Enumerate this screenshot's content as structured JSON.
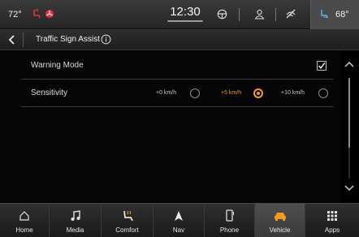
{
  "status_bar": {
    "temp_left": "72°",
    "clock": "12:30",
    "temp_right": "68°",
    "icons": [
      "heated-seat-icon",
      "fan-icon",
      "steering-wheel-icon",
      "user-icon",
      "no-wifi-icon",
      "seat-vent-icon"
    ]
  },
  "header": {
    "title": "Traffic Sign Assist",
    "back_icon": "chevron-left-icon",
    "info_icon": "info-icon"
  },
  "settings": {
    "warning_mode": {
      "label": "Warning Mode",
      "checked": true
    },
    "sensitivity": {
      "label": "Sensitivity",
      "options": [
        {
          "label": "+0 km/h",
          "selected": false
        },
        {
          "label": "+5 km/h",
          "selected": true
        },
        {
          "label": "+10 km/h",
          "selected": false
        }
      ]
    }
  },
  "nav": {
    "items": [
      {
        "label": "Home",
        "icon": "home-icon"
      },
      {
        "label": "Media",
        "icon": "music-note-icon"
      },
      {
        "label": "Comfort",
        "icon": "comfort-seat-icon"
      },
      {
        "label": "Nav",
        "icon": "navigation-arrow-icon"
      },
      {
        "label": "Phone",
        "icon": "phone-icon"
      },
      {
        "label": "Vehicle",
        "icon": "car-icon"
      },
      {
        "label": "Apps",
        "icon": "grid-icon"
      }
    ],
    "active": "Vehicle"
  },
  "colors": {
    "accent": "#f39a1e",
    "active_icon": "#f39a1e"
  }
}
